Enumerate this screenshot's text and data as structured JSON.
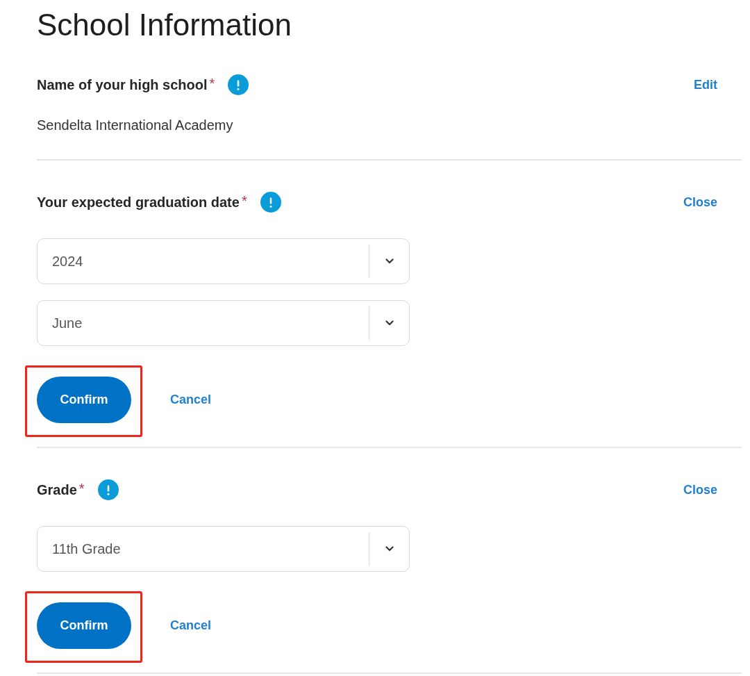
{
  "title": "School Information",
  "sections": [
    {
      "label": "Name of your high school",
      "required_mark": "*",
      "toggle_link": "Edit",
      "value": "Sendelta International Academy"
    },
    {
      "label": "Your expected graduation date",
      "required_mark": "*",
      "toggle_link": "Close",
      "dropdowns": [
        {
          "value": "2024"
        },
        {
          "value": "June"
        }
      ],
      "confirm_button": {
        "label": "Confirm",
        "highlighted": true
      },
      "cancel_link": "Cancel"
    },
    {
      "label": "Grade",
      "required_mark": "*",
      "toggle_link": "Close",
      "dropdowns": [
        {
          "value": "11th Grade"
        }
      ],
      "confirm_button": {
        "label": "Confirm",
        "highlighted": true
      },
      "cancel_link": "Cancel"
    }
  ]
}
